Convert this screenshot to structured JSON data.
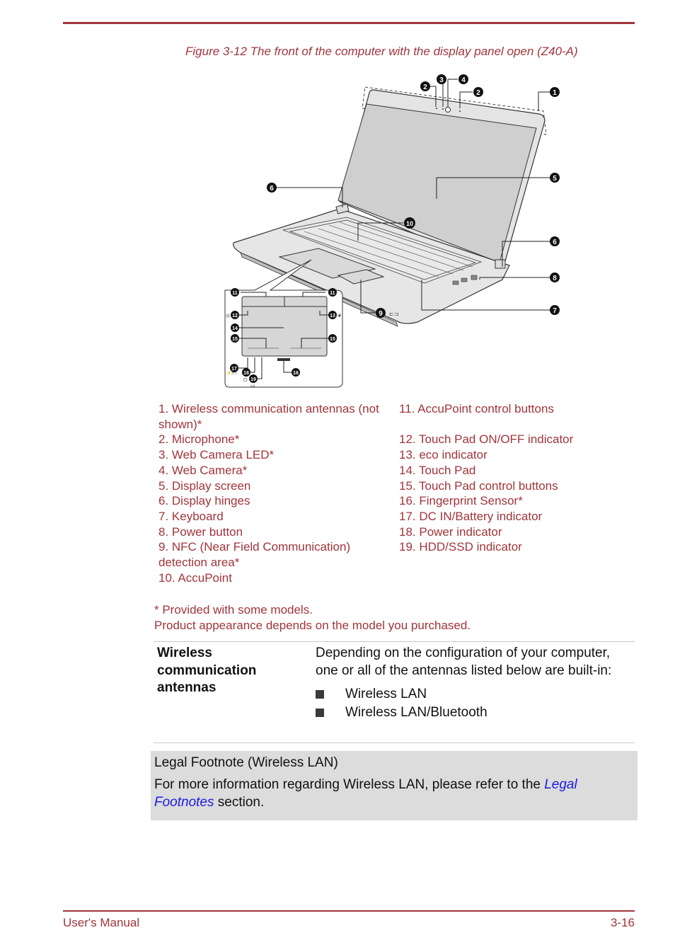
{
  "header": {
    "figure_caption": "Figure 3-12 The front of the computer with the display panel open (Z40-A)"
  },
  "figure": {
    "description": "Laptop front view with display open and numbered callouts",
    "callouts": [
      "1",
      "2",
      "3",
      "4",
      "2",
      "5",
      "6",
      "6",
      "7",
      "8",
      "9",
      "10",
      "11",
      "11",
      "12",
      "13",
      "14",
      "15",
      "15",
      "16",
      "17",
      "18",
      "19"
    ],
    "icons": [
      "touchpad-indicator-icon",
      "eco-icon",
      "nfc-icon",
      "dc-in-battery-icon",
      "power-icon",
      "hdd-icon"
    ]
  },
  "legend": {
    "left": [
      "1. Wireless communication antennas (not shown)*",
      "2. Microphone*",
      "3. Web Camera LED*",
      "4. Web Camera*",
      "5. Display screen",
      "6. Display hinges",
      "7. Keyboard",
      "8. Power button",
      "9. NFC (Near Field Communication) detection area*",
      "10. AccuPoint"
    ],
    "right": [
      "11. AccuPoint control buttons",
      "",
      "12. Touch Pad ON/OFF indicator",
      "13. eco indicator",
      "14. Touch Pad",
      "15. Touch Pad control buttons",
      "16. Fingerprint Sensor*",
      "17. DC IN/Battery indicator",
      "18. Power indicator",
      "19. HDD/SSD indicator"
    ]
  },
  "notes": {
    "line1": "* Provided with some models.",
    "line2": "Product appearance depends on the model you purchased."
  },
  "definition": {
    "term": "Wireless communication antennas",
    "description": "Depending on the configuration of your computer, one or all of the antennas listed below are built-in:",
    "items": [
      "Wireless LAN",
      "Wireless LAN/Bluetooth"
    ]
  },
  "legal_note": {
    "title": "Legal Footnote (Wireless LAN)",
    "body_prefix": "For more information regarding Wireless LAN, please refer to the ",
    "link_text": "Legal Footnotes",
    "body_suffix": " section."
  },
  "footer": {
    "left": "User's Manual",
    "right": "3-16"
  },
  "colors": {
    "accent": "#a0353a",
    "link": "#1a1ae6",
    "note_bg": "#dcdcdc"
  }
}
